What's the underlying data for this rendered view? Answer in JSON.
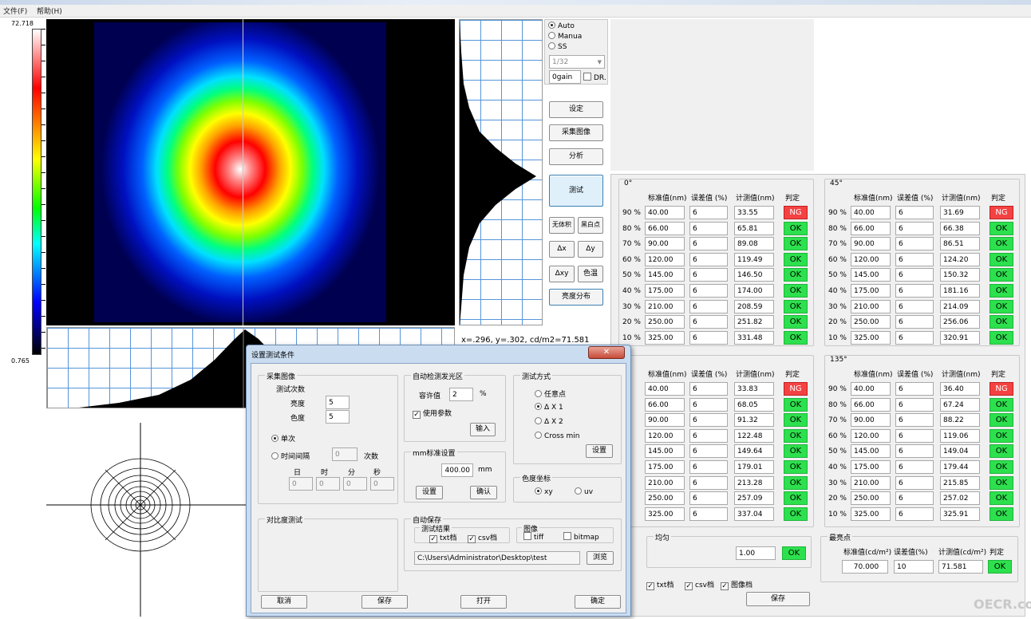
{
  "menu": {
    "file": "文件(F)",
    "help": "帮助(H)"
  },
  "colorbar": {
    "max": "72.718",
    "min": "0.765"
  },
  "coord_readout": "x=.296, y=.302, cd/m2=71.581",
  "exposure": {
    "auto": "Auto",
    "manual": "Manua",
    "ss": "SS",
    "shutter": "1/32",
    "gain": "0gain",
    "dr": "DR."
  },
  "buttons": {
    "settings": "设定",
    "capture": "采集图像",
    "analyze": "分析",
    "test": "测试",
    "dark_body": "无体积",
    "blackbody": "黑白点",
    "dx": "Δx",
    "dy": "Δy",
    "dxy": "Δxy",
    "color_temp": "色温",
    "luminance_dist": "亮度分布"
  },
  "table_headers": {
    "std": "标准值(nm)",
    "tol": "误差值 (%)",
    "meas": "计测值(nm)",
    "judge": "判定"
  },
  "quadrants": [
    {
      "angle": "0°",
      "rows": [
        {
          "pct": "90 %",
          "std": "40.00",
          "tol": "6",
          "meas": "33.55",
          "judge": "NG"
        },
        {
          "pct": "80 %",
          "std": "66.00",
          "tol": "6",
          "meas": "65.81",
          "judge": "OK"
        },
        {
          "pct": "70 %",
          "std": "90.00",
          "tol": "6",
          "meas": "89.08",
          "judge": "OK"
        },
        {
          "pct": "60 %",
          "std": "120.00",
          "tol": "6",
          "meas": "119.49",
          "judge": "OK"
        },
        {
          "pct": "50 %",
          "std": "145.00",
          "tol": "6",
          "meas": "146.50",
          "judge": "OK"
        },
        {
          "pct": "40 %",
          "std": "175.00",
          "tol": "6",
          "meas": "174.00",
          "judge": "OK"
        },
        {
          "pct": "30 %",
          "std": "210.00",
          "tol": "6",
          "meas": "208.59",
          "judge": "OK"
        },
        {
          "pct": "20 %",
          "std": "250.00",
          "tol": "6",
          "meas": "251.82",
          "judge": "OK"
        },
        {
          "pct": "10 %",
          "std": "325.00",
          "tol": "6",
          "meas": "331.48",
          "judge": "OK"
        }
      ]
    },
    {
      "angle": "45°",
      "rows": [
        {
          "pct": "90 %",
          "std": "40.00",
          "tol": "6",
          "meas": "31.69",
          "judge": "NG"
        },
        {
          "pct": "80 %",
          "std": "66.00",
          "tol": "6",
          "meas": "66.38",
          "judge": "OK"
        },
        {
          "pct": "70 %",
          "std": "90.00",
          "tol": "6",
          "meas": "86.51",
          "judge": "OK"
        },
        {
          "pct": "60 %",
          "std": "120.00",
          "tol": "6",
          "meas": "124.20",
          "judge": "OK"
        },
        {
          "pct": "50 %",
          "std": "145.00",
          "tol": "6",
          "meas": "150.32",
          "judge": "OK"
        },
        {
          "pct": "40 %",
          "std": "175.00",
          "tol": "6",
          "meas": "181.16",
          "judge": "OK"
        },
        {
          "pct": "30 %",
          "std": "210.00",
          "tol": "6",
          "meas": "214.09",
          "judge": "OK"
        },
        {
          "pct": "20 %",
          "std": "250.00",
          "tol": "6",
          "meas": "256.06",
          "judge": "OK"
        },
        {
          "pct": "10 %",
          "std": "325.00",
          "tol": "6",
          "meas": "320.91",
          "judge": "OK"
        }
      ]
    },
    {
      "angle": "",
      "rows": [
        {
          "pct": "%",
          "std": "40.00",
          "tol": "6",
          "meas": "33.83",
          "judge": "NG"
        },
        {
          "pct": "%",
          "std": "66.00",
          "tol": "6",
          "meas": "68.05",
          "judge": "OK"
        },
        {
          "pct": "%",
          "std": "90.00",
          "tol": "6",
          "meas": "91.32",
          "judge": "OK"
        },
        {
          "pct": "%",
          "std": "120.00",
          "tol": "6",
          "meas": "122.48",
          "judge": "OK"
        },
        {
          "pct": "%",
          "std": "145.00",
          "tol": "6",
          "meas": "149.64",
          "judge": "OK"
        },
        {
          "pct": "%",
          "std": "175.00",
          "tol": "6",
          "meas": "179.01",
          "judge": "OK"
        },
        {
          "pct": "%",
          "std": "210.00",
          "tol": "6",
          "meas": "213.28",
          "judge": "OK"
        },
        {
          "pct": "%",
          "std": "250.00",
          "tol": "6",
          "meas": "257.09",
          "judge": "OK"
        },
        {
          "pct": "%",
          "std": "325.00",
          "tol": "6",
          "meas": "337.04",
          "judge": "OK"
        }
      ]
    },
    {
      "angle": "135°",
      "rows": [
        {
          "pct": "90 %",
          "std": "40.00",
          "tol": "6",
          "meas": "36.40",
          "judge": "NG"
        },
        {
          "pct": "80 %",
          "std": "66.00",
          "tol": "6",
          "meas": "67.24",
          "judge": "OK"
        },
        {
          "pct": "70 %",
          "std": "90.00",
          "tol": "6",
          "meas": "88.22",
          "judge": "OK"
        },
        {
          "pct": "60 %",
          "std": "120.00",
          "tol": "6",
          "meas": "119.06",
          "judge": "OK"
        },
        {
          "pct": "50 %",
          "std": "145.00",
          "tol": "6",
          "meas": "149.04",
          "judge": "OK"
        },
        {
          "pct": "40 %",
          "std": "175.00",
          "tol": "6",
          "meas": "179.44",
          "judge": "OK"
        },
        {
          "pct": "30 %",
          "std": "210.00",
          "tol": "6",
          "meas": "215.85",
          "judge": "OK"
        },
        {
          "pct": "20 %",
          "std": "250.00",
          "tol": "6",
          "meas": "257.02",
          "judge": "OK"
        },
        {
          "pct": "10 %",
          "std": "325.00",
          "tol": "6",
          "meas": "325.91",
          "judge": "OK"
        }
      ]
    }
  ],
  "uniformity": {
    "title": "均匀",
    "value": "1.00",
    "judge": "OK"
  },
  "brightest": {
    "title": "最亮点",
    "std_label": "标准值(cd/m²)",
    "tol_label": "误差值(%)",
    "meas_label": "计测值(cd/m²)",
    "judge_label": "判定",
    "std": "70.000",
    "tol": "10",
    "meas": "71.581",
    "judge": "OK"
  },
  "save_opts": {
    "txt": "txt档",
    "csv": "csv档",
    "img": "图像档",
    "save": "保存"
  },
  "dialog": {
    "title": "设置测试条件",
    "capture_group": "采集图像",
    "count_label": "测试次数",
    "bright_label": "亮度",
    "bright_val": "5",
    "color_label": "色度",
    "color_val": "5",
    "single": "单次",
    "interval": "时间间隔",
    "interval_val": "0",
    "times": "次数",
    "day": "日",
    "hour": "时",
    "minute": "分",
    "second": "秒",
    "d_val": "0",
    "h_val": "0",
    "m_val": "0",
    "s_val": "0",
    "contrast_group": "对比度测试",
    "auto_detect_group": "自动检测发光区",
    "threshold_label": "容许值",
    "threshold_val": "2",
    "threshold_unit": "%",
    "use_params": "使用参数",
    "input_btn": "输入",
    "mm_group": "mm标准设置",
    "mm_val": "400.00",
    "mm_unit": "mm",
    "setup_btn": "设置",
    "confirm_btn": "确认",
    "test_mode_group": "测试方式",
    "mode_any": "任意点",
    "mode_d1": "Δ X 1",
    "mode_d2": "Δ X 2",
    "mode_cross": "Cross min",
    "mode_set_btn": "设置",
    "chroma_group": "色度坐标",
    "xy": "xy",
    "uv": "uv",
    "autosave_group": "自动保存",
    "results_group": "测试结果",
    "txt": "txt档",
    "csv": "csv档",
    "image_group": "图像",
    "tiff": "tiff",
    "bmp": "bitmap",
    "path": "C:\\Users\\Administrator\\Desktop\\test",
    "browse_btn": "浏览",
    "cancel_btn": "取消",
    "save_btn": "保存",
    "open_btn": "打开",
    "ok_btn": "确定"
  },
  "watermark": "OECR.com"
}
